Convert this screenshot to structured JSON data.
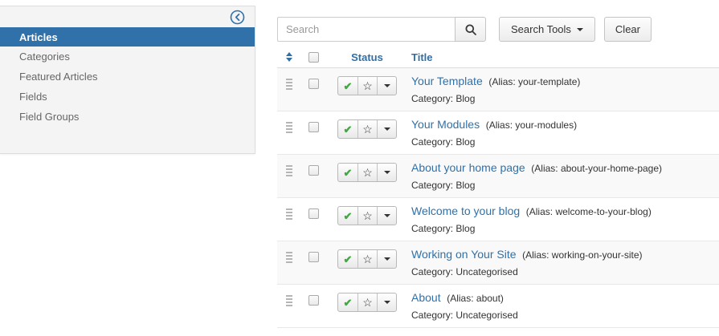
{
  "colors": {
    "accent_blue": "#3071a9",
    "check_green": "#46a546"
  },
  "sidebar": {
    "items": [
      {
        "label": "Articles"
      },
      {
        "label": "Categories"
      },
      {
        "label": "Featured Articles"
      },
      {
        "label": "Fields"
      },
      {
        "label": "Field Groups"
      }
    ]
  },
  "filters": {
    "search_placeholder": "Search",
    "search_tools_label": "Search Tools",
    "clear_label": "Clear"
  },
  "table": {
    "headers": {
      "status": "Status",
      "title": "Title"
    },
    "icons": {
      "check": "✔",
      "star": "☆"
    },
    "rows": [
      {
        "title": "Your Template",
        "alias": "(Alias: your-template)",
        "category": "Category: Blog"
      },
      {
        "title": "Your Modules",
        "alias": "(Alias: your-modules)",
        "category": "Category: Blog"
      },
      {
        "title": "About your home page",
        "alias": "(Alias: about-your-home-page)",
        "category": "Category: Blog"
      },
      {
        "title": "Welcome to your blog",
        "alias": "(Alias: welcome-to-your-blog)",
        "category": "Category: Blog"
      },
      {
        "title": "Working on Your Site",
        "alias": "(Alias: working-on-your-site)",
        "category": "Category: Uncategorised"
      },
      {
        "title": "About",
        "alias": "(Alias: about)",
        "category": "Category: Uncategorised"
      }
    ]
  }
}
